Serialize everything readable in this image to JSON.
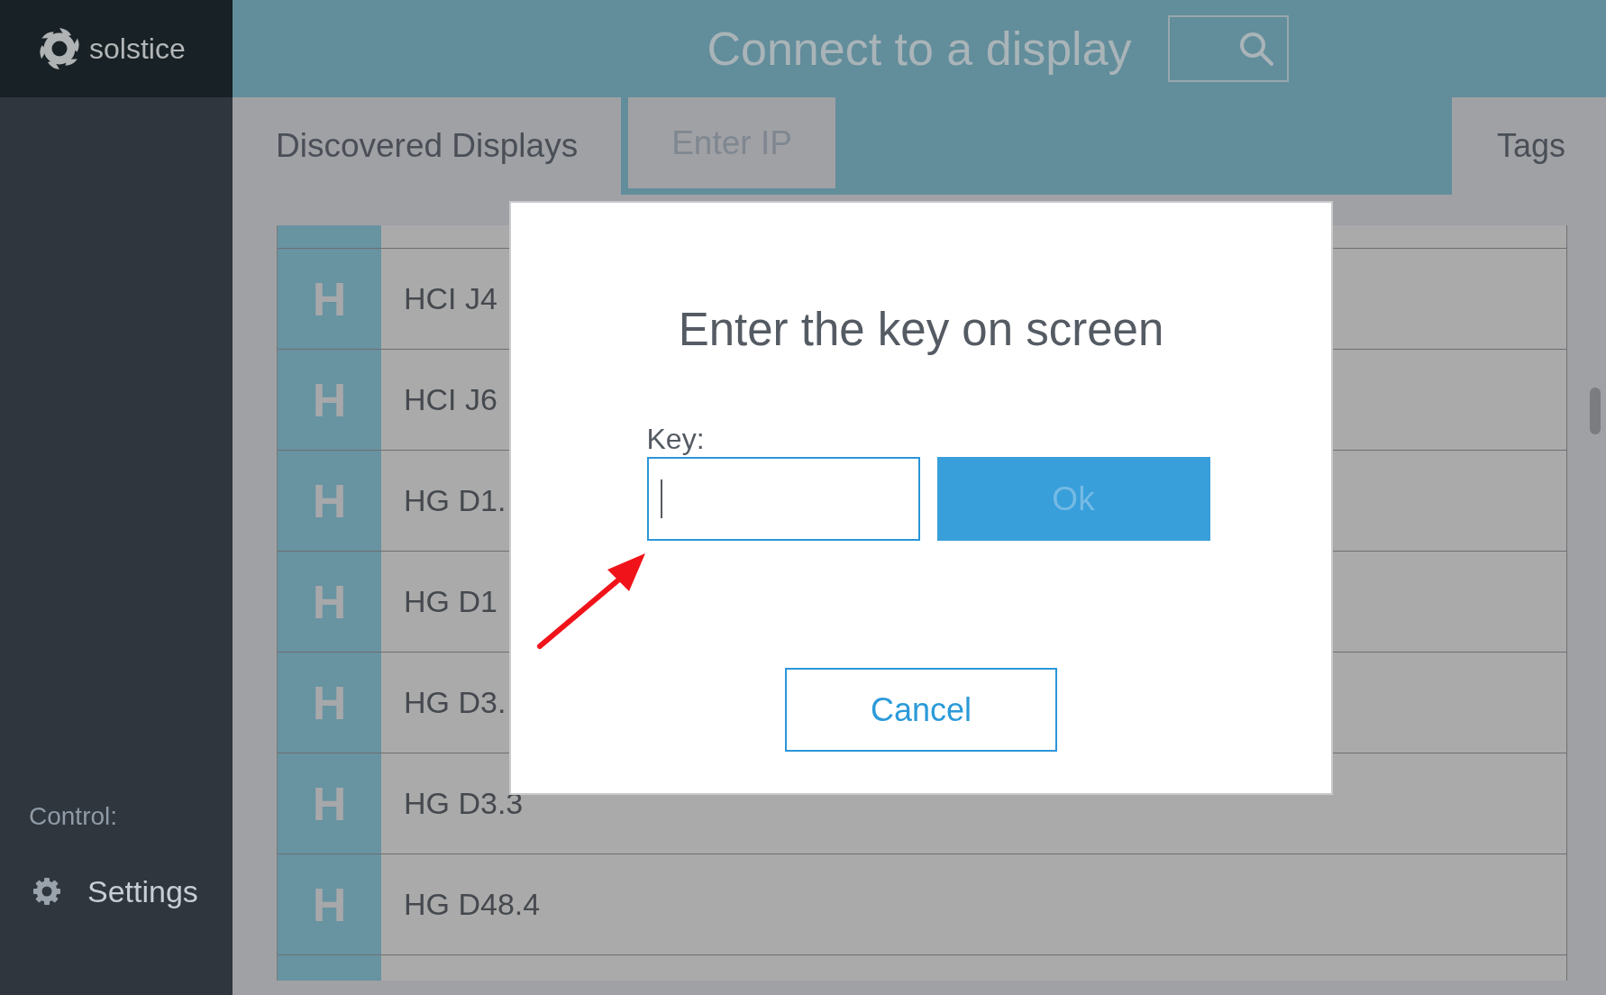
{
  "sidebar": {
    "logo_text": "solstice",
    "section_label": "Control:",
    "items": [
      {
        "label": "Settings"
      }
    ]
  },
  "header": {
    "title": "Connect to a display"
  },
  "tabs": [
    {
      "label": "Discovered Displays",
      "selected": true
    },
    {
      "label": "Enter IP",
      "selected": false
    }
  ],
  "tags_button": {
    "label": "Tags"
  },
  "display_list": {
    "rows": [
      {
        "initial": "H",
        "name": "HCI J4"
      },
      {
        "initial": "H",
        "name": "HCI J6"
      },
      {
        "initial": "H",
        "name": "HG D1."
      },
      {
        "initial": "H",
        "name": "HG D1"
      },
      {
        "initial": "H",
        "name": "HG D3."
      },
      {
        "initial": "H",
        "name": "HG D3.3"
      },
      {
        "initial": "H",
        "name": "HG D48.4"
      }
    ]
  },
  "dialog": {
    "title": "Enter the key on screen",
    "field": {
      "label": "Key:",
      "focused": true
    },
    "ok_button": {
      "label": "Ok",
      "disabled": true
    },
    "cancel_button": {
      "label": "Cancel"
    }
  }
}
